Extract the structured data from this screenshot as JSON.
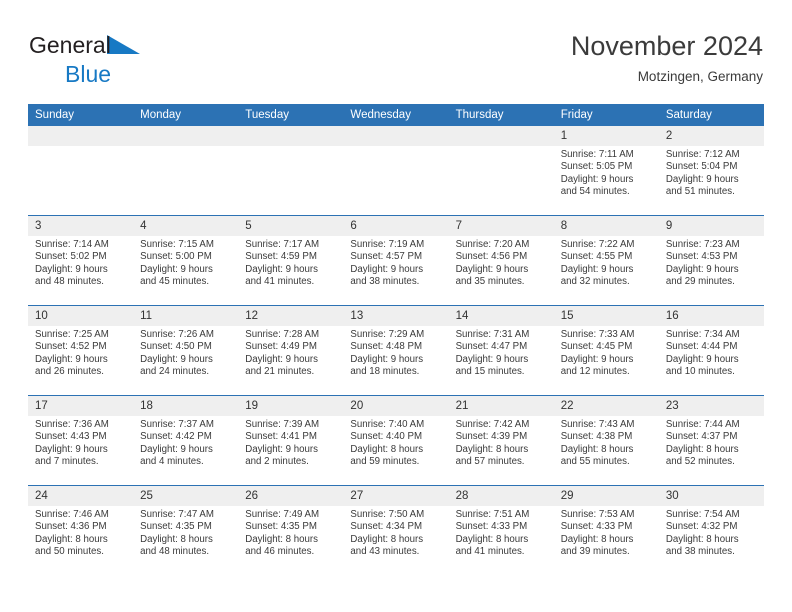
{
  "brand": {
    "name_part1": "General",
    "name_part2": "Blue",
    "flag_icon": "triangle-flag-icon",
    "colors": {
      "dark": "#231f20",
      "blue": "#1779c4"
    }
  },
  "header": {
    "title": "November 2024",
    "subtitle": "Motzingen, Germany"
  },
  "theme": {
    "header_blue": "#2c72b4",
    "daynum_gray": "#efefef",
    "text": "#3a3a3a"
  },
  "calendar": {
    "weekday_headers": [
      "Sunday",
      "Monday",
      "Tuesday",
      "Wednesday",
      "Thursday",
      "Friday",
      "Saturday"
    ],
    "weeks": [
      [
        {
          "day": "",
          "lines": []
        },
        {
          "day": "",
          "lines": []
        },
        {
          "day": "",
          "lines": []
        },
        {
          "day": "",
          "lines": []
        },
        {
          "day": "",
          "lines": []
        },
        {
          "day": "1",
          "lines": [
            "Sunrise: 7:11 AM",
            "Sunset: 5:05 PM",
            "Daylight: 9 hours",
            "and 54 minutes."
          ]
        },
        {
          "day": "2",
          "lines": [
            "Sunrise: 7:12 AM",
            "Sunset: 5:04 PM",
            "Daylight: 9 hours",
            "and 51 minutes."
          ]
        }
      ],
      [
        {
          "day": "3",
          "lines": [
            "Sunrise: 7:14 AM",
            "Sunset: 5:02 PM",
            "Daylight: 9 hours",
            "and 48 minutes."
          ]
        },
        {
          "day": "4",
          "lines": [
            "Sunrise: 7:15 AM",
            "Sunset: 5:00 PM",
            "Daylight: 9 hours",
            "and 45 minutes."
          ]
        },
        {
          "day": "5",
          "lines": [
            "Sunrise: 7:17 AM",
            "Sunset: 4:59 PM",
            "Daylight: 9 hours",
            "and 41 minutes."
          ]
        },
        {
          "day": "6",
          "lines": [
            "Sunrise: 7:19 AM",
            "Sunset: 4:57 PM",
            "Daylight: 9 hours",
            "and 38 minutes."
          ]
        },
        {
          "day": "7",
          "lines": [
            "Sunrise: 7:20 AM",
            "Sunset: 4:56 PM",
            "Daylight: 9 hours",
            "and 35 minutes."
          ]
        },
        {
          "day": "8",
          "lines": [
            "Sunrise: 7:22 AM",
            "Sunset: 4:55 PM",
            "Daylight: 9 hours",
            "and 32 minutes."
          ]
        },
        {
          "day": "9",
          "lines": [
            "Sunrise: 7:23 AM",
            "Sunset: 4:53 PM",
            "Daylight: 9 hours",
            "and 29 minutes."
          ]
        }
      ],
      [
        {
          "day": "10",
          "lines": [
            "Sunrise: 7:25 AM",
            "Sunset: 4:52 PM",
            "Daylight: 9 hours",
            "and 26 minutes."
          ]
        },
        {
          "day": "11",
          "lines": [
            "Sunrise: 7:26 AM",
            "Sunset: 4:50 PM",
            "Daylight: 9 hours",
            "and 24 minutes."
          ]
        },
        {
          "day": "12",
          "lines": [
            "Sunrise: 7:28 AM",
            "Sunset: 4:49 PM",
            "Daylight: 9 hours",
            "and 21 minutes."
          ]
        },
        {
          "day": "13",
          "lines": [
            "Sunrise: 7:29 AM",
            "Sunset: 4:48 PM",
            "Daylight: 9 hours",
            "and 18 minutes."
          ]
        },
        {
          "day": "14",
          "lines": [
            "Sunrise: 7:31 AM",
            "Sunset: 4:47 PM",
            "Daylight: 9 hours",
            "and 15 minutes."
          ]
        },
        {
          "day": "15",
          "lines": [
            "Sunrise: 7:33 AM",
            "Sunset: 4:45 PM",
            "Daylight: 9 hours",
            "and 12 minutes."
          ]
        },
        {
          "day": "16",
          "lines": [
            "Sunrise: 7:34 AM",
            "Sunset: 4:44 PM",
            "Daylight: 9 hours",
            "and 10 minutes."
          ]
        }
      ],
      [
        {
          "day": "17",
          "lines": [
            "Sunrise: 7:36 AM",
            "Sunset: 4:43 PM",
            "Daylight: 9 hours",
            "and 7 minutes."
          ]
        },
        {
          "day": "18",
          "lines": [
            "Sunrise: 7:37 AM",
            "Sunset: 4:42 PM",
            "Daylight: 9 hours",
            "and 4 minutes."
          ]
        },
        {
          "day": "19",
          "lines": [
            "Sunrise: 7:39 AM",
            "Sunset: 4:41 PM",
            "Daylight: 9 hours",
            "and 2 minutes."
          ]
        },
        {
          "day": "20",
          "lines": [
            "Sunrise: 7:40 AM",
            "Sunset: 4:40 PM",
            "Daylight: 8 hours",
            "and 59 minutes."
          ]
        },
        {
          "day": "21",
          "lines": [
            "Sunrise: 7:42 AM",
            "Sunset: 4:39 PM",
            "Daylight: 8 hours",
            "and 57 minutes."
          ]
        },
        {
          "day": "22",
          "lines": [
            "Sunrise: 7:43 AM",
            "Sunset: 4:38 PM",
            "Daylight: 8 hours",
            "and 55 minutes."
          ]
        },
        {
          "day": "23",
          "lines": [
            "Sunrise: 7:44 AM",
            "Sunset: 4:37 PM",
            "Daylight: 8 hours",
            "and 52 minutes."
          ]
        }
      ],
      [
        {
          "day": "24",
          "lines": [
            "Sunrise: 7:46 AM",
            "Sunset: 4:36 PM",
            "Daylight: 8 hours",
            "and 50 minutes."
          ]
        },
        {
          "day": "25",
          "lines": [
            "Sunrise: 7:47 AM",
            "Sunset: 4:35 PM",
            "Daylight: 8 hours",
            "and 48 minutes."
          ]
        },
        {
          "day": "26",
          "lines": [
            "Sunrise: 7:49 AM",
            "Sunset: 4:35 PM",
            "Daylight: 8 hours",
            "and 46 minutes."
          ]
        },
        {
          "day": "27",
          "lines": [
            "Sunrise: 7:50 AM",
            "Sunset: 4:34 PM",
            "Daylight: 8 hours",
            "and 43 minutes."
          ]
        },
        {
          "day": "28",
          "lines": [
            "Sunrise: 7:51 AM",
            "Sunset: 4:33 PM",
            "Daylight: 8 hours",
            "and 41 minutes."
          ]
        },
        {
          "day": "29",
          "lines": [
            "Sunrise: 7:53 AM",
            "Sunset: 4:33 PM",
            "Daylight: 8 hours",
            "and 39 minutes."
          ]
        },
        {
          "day": "30",
          "lines": [
            "Sunrise: 7:54 AM",
            "Sunset: 4:32 PM",
            "Daylight: 8 hours",
            "and 38 minutes."
          ]
        }
      ]
    ]
  }
}
